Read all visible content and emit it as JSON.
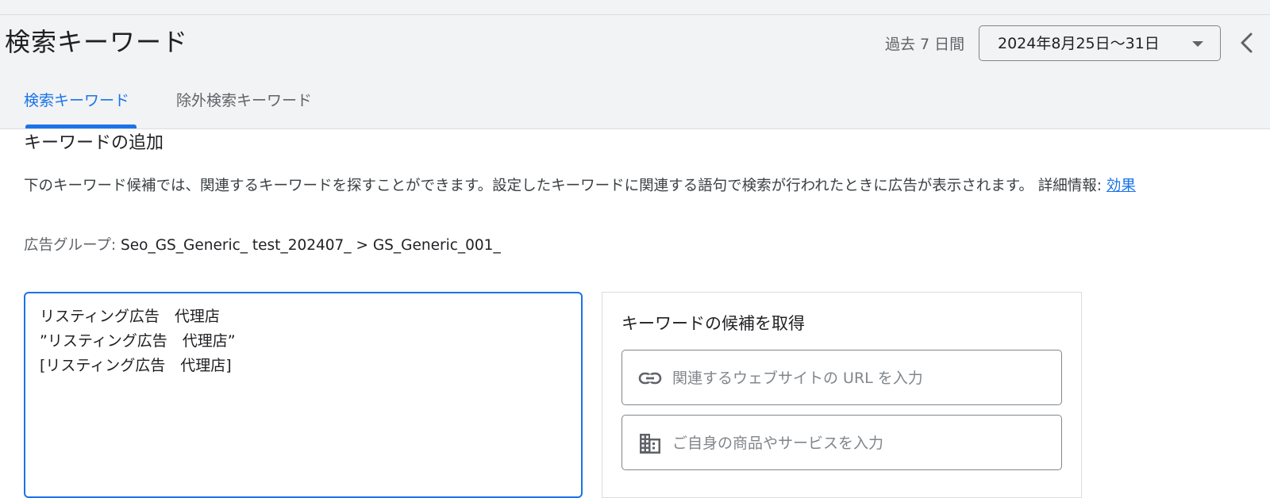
{
  "header": {
    "title": "検索キーワード",
    "range_label": "過去 7 日間",
    "date_range": "2024年8月25日〜31日"
  },
  "tabs": [
    {
      "label": "検索キーワード",
      "active": true
    },
    {
      "label": "除外検索キーワード",
      "active": false
    }
  ],
  "section": {
    "title": "キーワードの追加",
    "description": "下のキーワード候補では、関連するキーワードを探すことができます。設定したキーワードに関連する語句で検索が行われたときに広告が表示されます。 詳細情報: ",
    "help_link": "効果"
  },
  "ad_group": {
    "label": "広告グループ: ",
    "value": "Seo_GS_Generic_ test_202407_ > GS_Generic_001_"
  },
  "keywords": [
    "リスティング広告　代理店",
    "”リスティング広告　代理店”",
    "[リスティング広告　代理店]"
  ],
  "suggestions": {
    "title": "キーワードの候補を取得",
    "url_placeholder": "関連するウェブサイトの URL を入力",
    "product_placeholder": "ご自身の商品やサービスを入力"
  },
  "icons": {
    "url": "link-icon",
    "product": "business-icon",
    "collapse": "chevron-left-icon",
    "dropdown": "arrow-drop-down-icon"
  },
  "colors": {
    "accent": "#1a73e8",
    "header_bg": "#f1f3f4"
  }
}
